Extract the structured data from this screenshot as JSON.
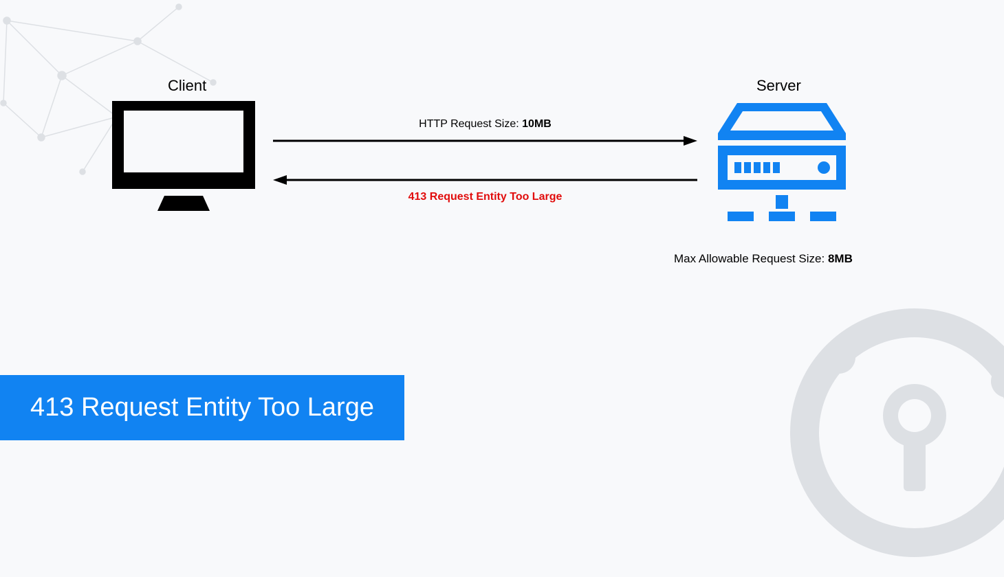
{
  "labels": {
    "client": "Client",
    "server": "Server"
  },
  "request": {
    "label_prefix": "HTTP Request Size: ",
    "label_value": "10MB"
  },
  "response": {
    "label": "413 Request Entity Too Large"
  },
  "server_info": {
    "prefix": "Max Allowable Request Size: ",
    "value": "8MB"
  },
  "title": "413 Request Entity Too Large",
  "colors": {
    "banner": "#1183f2",
    "server_icon": "#1183f2",
    "error_text": "#e10c0c",
    "decor": "#dde0e4"
  }
}
